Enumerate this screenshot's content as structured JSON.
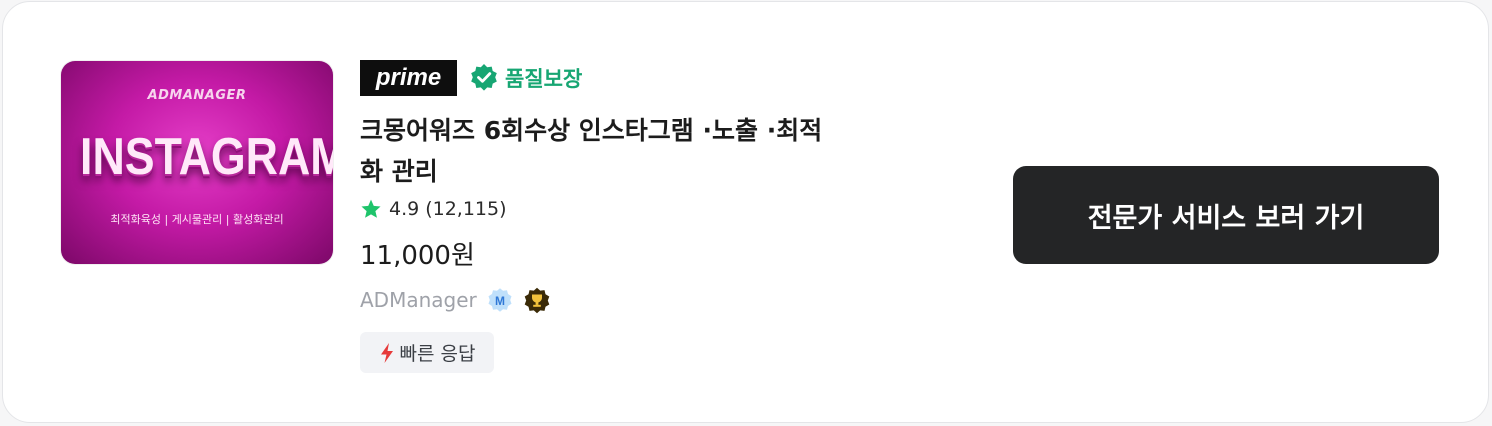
{
  "thumbnail": {
    "brand": "ADMANAGER",
    "headline": "INSTAGRAM",
    "subline": "최적화육성 | 게시물관리 | 활성화관리"
  },
  "badges": {
    "prime": "prime",
    "quality": "품질보장"
  },
  "title": "크몽어워즈 6회수상 인스타그램 ·노출 ·최적화 관리",
  "rating": {
    "score": "4.9",
    "count": "(12,115)"
  },
  "price": "11,000원",
  "seller": {
    "name": "ADManager",
    "level_icon": "M"
  },
  "tags": {
    "fast_response": "빠른 응답"
  },
  "cta": {
    "label": "전문가 서비스 보러 가기"
  },
  "colors": {
    "quality_green": "#17a673",
    "star_green": "#1fc46b",
    "cta_bg": "#242526",
    "thumb_magenta": "#c41aa6",
    "bolt_red": "#e63a3a"
  }
}
